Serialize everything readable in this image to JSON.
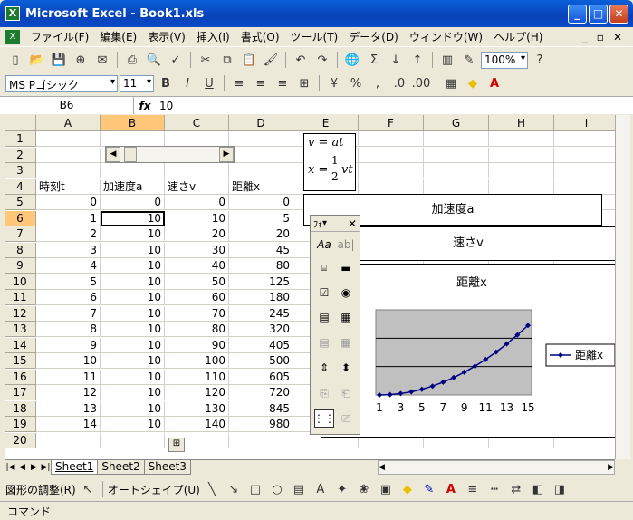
{
  "window": {
    "title": "Microsoft Excel - Book1.xls"
  },
  "menu": [
    "ファイル(F)",
    "編集(E)",
    "表示(V)",
    "挿入(I)",
    "書式(O)",
    "ツール(T)",
    "データ(D)",
    "ウィンドウ(W)",
    "ヘルプ(H)"
  ],
  "toolbar": {
    "zoom": "100%",
    "font": "MS Pゴシック",
    "font_size": "11"
  },
  "formula_bar": {
    "name_box": "B6",
    "fx": "fx",
    "value": "10"
  },
  "columns": [
    "A",
    "B",
    "C",
    "D",
    "E",
    "F",
    "G",
    "H",
    "I"
  ],
  "rows": [
    "1",
    "2",
    "3",
    "4",
    "5",
    "6",
    "7",
    "8",
    "9",
    "10",
    "11",
    "12",
    "13",
    "14",
    "15",
    "16",
    "17",
    "18",
    "19",
    "20"
  ],
  "headers": [
    "時刻t",
    "加速度a",
    "速さv",
    "距離x"
  ],
  "table": [
    [
      "0",
      "0",
      "0",
      "0"
    ],
    [
      "1",
      "10",
      "10",
      "5"
    ],
    [
      "2",
      "10",
      "20",
      "20"
    ],
    [
      "3",
      "10",
      "30",
      "45"
    ],
    [
      "4",
      "10",
      "40",
      "80"
    ],
    [
      "5",
      "10",
      "50",
      "125"
    ],
    [
      "6",
      "10",
      "60",
      "180"
    ],
    [
      "7",
      "10",
      "70",
      "245"
    ],
    [
      "8",
      "10",
      "80",
      "320"
    ],
    [
      "9",
      "10",
      "90",
      "405"
    ],
    [
      "10",
      "10",
      "100",
      "500"
    ],
    [
      "11",
      "10",
      "110",
      "605"
    ],
    [
      "12",
      "10",
      "120",
      "720"
    ],
    [
      "13",
      "10",
      "130",
      "845"
    ],
    [
      "14",
      "10",
      "140",
      "980"
    ]
  ],
  "equations": {
    "line1": "v = at",
    "line2_lhs": "x =",
    "line2_num": "1",
    "line2_den": "2",
    "line2_rhs": "vt"
  },
  "labels": {
    "accel": "加速度a",
    "speed": "速さv"
  },
  "palette": {
    "title": "ﾌｫ"
  },
  "sheets": [
    "Sheet1",
    "Sheet2",
    "Sheet3"
  ],
  "drawing_toolbar": {
    "adjust": "図形の調整(R)",
    "autoshape": "オートシェイプ(U)"
  },
  "status": "コマンド",
  "chart_data": {
    "type": "line",
    "title": "距離x",
    "categories": [
      "1",
      "2",
      "3",
      "4",
      "5",
      "6",
      "7",
      "8",
      "9",
      "10",
      "11",
      "12",
      "13",
      "14",
      "15"
    ],
    "tick_labels": [
      "1",
      "3",
      "5",
      "7",
      "9",
      "11",
      "13",
      "15"
    ],
    "series": [
      {
        "name": "距離x",
        "values": [
          0,
          5,
          20,
          45,
          80,
          125,
          180,
          245,
          320,
          405,
          500,
          605,
          720,
          845,
          980
        ],
        "color": "#000080"
      }
    ],
    "ylim": [
      0,
      1200
    ],
    "grid": true,
    "legend": "right",
    "plot_bg": "#c0c0c0"
  }
}
